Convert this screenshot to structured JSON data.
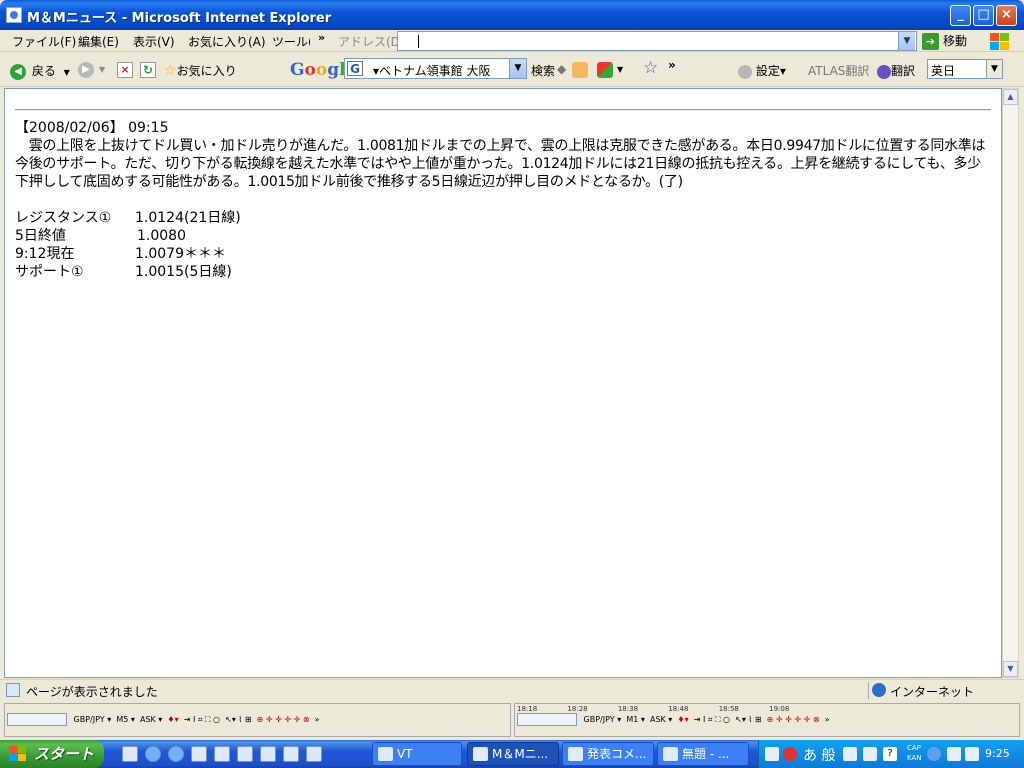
{
  "window": {
    "title": "M＆Mニュース - Microsoft Internet Explorer"
  },
  "menu": {
    "items": [
      "ファイル(F)",
      "編集(E)",
      "表示(V)",
      "お気に入り(A)",
      "ツール(T)"
    ],
    "more": "»",
    "address_label": "アドレス(D)",
    "go_label": "移動"
  },
  "toolbar": {
    "back_label": "戻る",
    "favorites_label": "お気に入り",
    "google_logo": "Google",
    "google_search_value": "▾ベトナム領事館 大阪",
    "search_label": "検索",
    "more": "»",
    "settings_label": "設定▾",
    "atlas_label": "ATLAS翻訳",
    "translate_label": "翻訳",
    "lang_value": "英日"
  },
  "article": {
    "dateline": "【2008/02/06】 09:15",
    "body": "　雲の上限を上抜けてドル買い・加ドル売りが進んだ。1.0081加ドルまでの上昇で、雲の上限は克服できた感がある。本日0.9947加ドルに位置する同水準は今後のサポート。ただ、切り下がる転換線を越えた水準ではやや上値が重かった。1.0124加ドルには21日線の抵抗も控える。上昇を継続するにしても、多少下押しして底固めする可能性がある。1.0015加ドル前後で推移する5日線近辺が押し目のメドとなるか。(了)",
    "quotes": [
      {
        "label": "レジスタンス①",
        "value": "1.0124(21日線)"
      },
      {
        "label": "5日終値",
        "value": "1.0080"
      },
      {
        "label": "9:12現在",
        "value": "1.0079＊＊＊"
      },
      {
        "label": "サポート①",
        "value": "1.0015(5日線)"
      }
    ]
  },
  "status": {
    "text": "ページが表示されました",
    "zone": "インターネット"
  },
  "mt_left": {
    "symbol": "GBP/JPY ▾",
    "period": "M5 ▾",
    "price_type": "ASK ▾",
    "more": "»"
  },
  "mt_right": {
    "symbol": "GBP/JPY ▾",
    "period": "M1 ▾",
    "price_type": "ASK ▾",
    "ticks": [
      "18:18",
      "18:28",
      "18:38",
      "18:48",
      "18:58",
      "19:08"
    ],
    "more": "»"
  },
  "taskbar": {
    "start_label": "スタート",
    "tasks": [
      {
        "label": "VT",
        "active": false
      },
      {
        "label": "M＆Mニ...",
        "active": true
      },
      {
        "label": "発表コメ...",
        "active": false
      },
      {
        "label": "無題 - ...",
        "active": false
      }
    ],
    "ime_text": "あ 般",
    "clock": "9:25"
  },
  "colors": {
    "titlebar": "#0b55d8",
    "taskbar": "#2157d7",
    "start": "#379b33",
    "tray": "#1290e8"
  }
}
